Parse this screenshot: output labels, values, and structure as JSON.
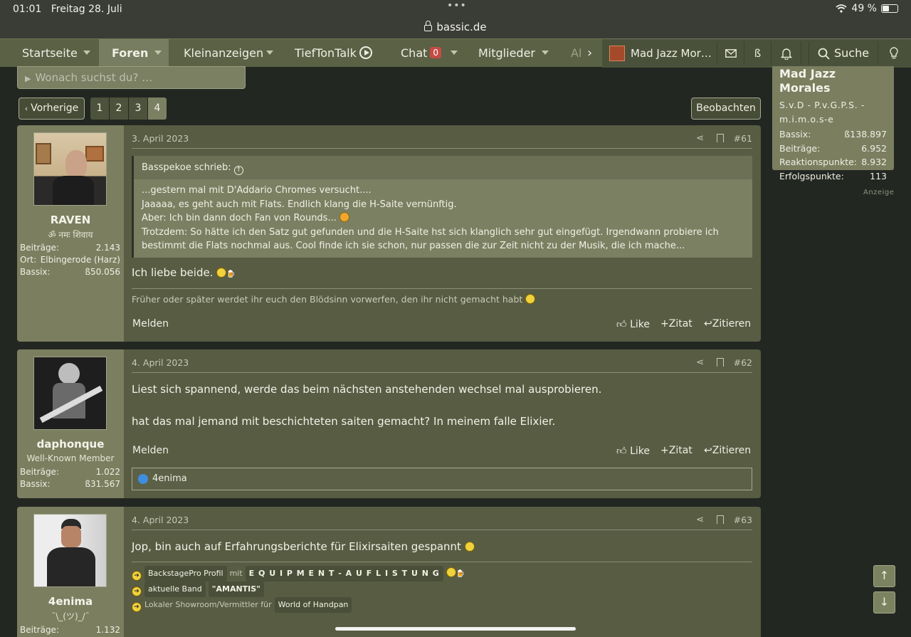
{
  "status": {
    "time": "01:01",
    "date": "Freitag 28. Juli",
    "battery": "49 %",
    "url": "bassic.de"
  },
  "nav": {
    "items": [
      "Startseite",
      "Foren",
      "Kleinanzeigen",
      "TiefTonTalk",
      "Chat",
      "Mitglieder",
      "Al"
    ],
    "chat_count": "0",
    "user": "Mad Jazz Mor…",
    "bass_symbol": "ß",
    "search_label": "Suche"
  },
  "search": {
    "placeholder": "Wonach suchst du? …"
  },
  "pagination": {
    "prev": "Vorherige",
    "pages": [
      "1",
      "2",
      "3",
      "4"
    ],
    "current": "4",
    "watch": "Beobachten"
  },
  "userbox": {
    "name": "Mad Jazz Morales",
    "title": "S.v.D - P.v.G.P.S. - m.i.m.o.s-e",
    "stats": [
      {
        "k": "Bassix:",
        "v": "ß138.897"
      },
      {
        "k": "Beiträge:",
        "v": "6.952"
      },
      {
        "k": "Reaktionspunkte:",
        "v": "8.932"
      },
      {
        "k": "Erfolgspunkte:",
        "v": "113"
      }
    ],
    "ad_label": "Anzeige"
  },
  "posts": [
    {
      "user": "RAVEN",
      "title": "ॐ नमः शिवाय",
      "stats": [
        {
          "k": "Beiträge:",
          "v": "2.143"
        },
        {
          "k": "Ort:",
          "v": "Elbingerode (Harz)"
        },
        {
          "k": "Bassix:",
          "v": "ß50.056"
        }
      ],
      "date": "3. April 2023",
      "num": "#61",
      "quote_author": "Basspekoe schrieb:",
      "quote_lines": [
        "...gestern mal mit D'Addario Chromes versucht....",
        "Jaaaaa, es geht auch mit Flats. Endlich klang die H-Saite vernünftig.",
        "Aber: Ich bin dann doch Fan von Rounds...",
        "Trotzdem: So hätte ich den Satz gut gefunden und die H-Saite hst sich klanglich sehr gut eingefügt. Irgendwann probiere ich bestimmt die Flats nochmal aus. Cool finde ich sie schon, nur passen die zur Zeit nicht zu der Musik, die ich mache..."
      ],
      "text": "Ich liebe beide.",
      "signature": "Früher oder später werdet ihr euch den Blödsinn vorwerfen, den ihr nicht gemacht habt"
    },
    {
      "user": "daphonque",
      "title": "Well-Known Member",
      "stats": [
        {
          "k": "Beiträge:",
          "v": "1.022"
        },
        {
          "k": "Bassix:",
          "v": "ß31.567"
        }
      ],
      "date": "4. April 2023",
      "num": "#62",
      "text1": "Liest sich spannend, werde das beim nächsten anstehenden wechsel mal ausprobieren.",
      "text2": "hat das mal jemand mit beschichteten saiten gemacht? In meinem falle Elixier.",
      "reaction": "4enima"
    },
    {
      "user": "4enima",
      "title": "¯\\_(ツ)_/¯",
      "stats": [
        {
          "k": "Beiträge:",
          "v": "1.132"
        }
      ],
      "date": "4. April 2023",
      "num": "#63",
      "text": "Jop, bin auch auf Erfahrungsberichte für Elixirsaiten gespannt",
      "sig1_a": "BackstagePro Profil",
      "sig1_mid": "mit",
      "sig1_b": "E Q U I P M E N T - A U F L I S T U N G",
      "sig2_a": "aktuelle Band",
      "sig2_b": "\"AMANTIS\"",
      "sig3_pre": "Lokaler Showroom/Vermittler für",
      "sig3_b": "World of Handpan"
    }
  ],
  "actions": {
    "report": "Melden",
    "like": "Like",
    "quote_add": "Zitat",
    "reply": "Zitieren"
  }
}
